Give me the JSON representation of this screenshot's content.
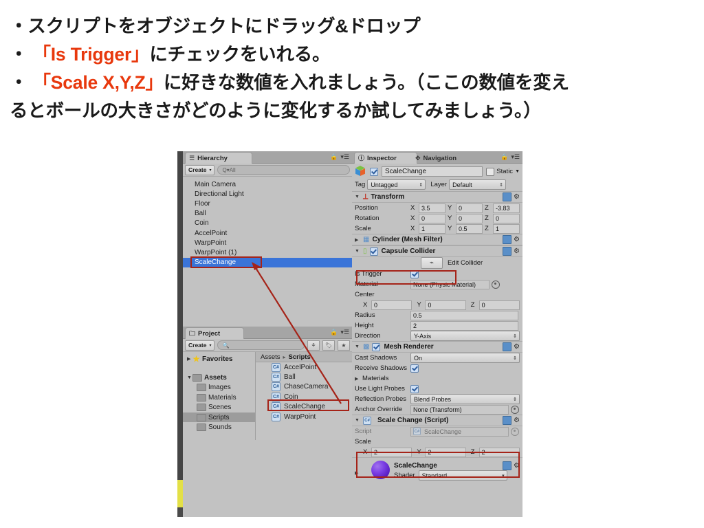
{
  "slide": {
    "lines": [
      {
        "id": "l1",
        "segments": [
          {
            "text": "・スクリプトをオブジェクトにドラッグ&ドロップ",
            "color": "black"
          }
        ]
      },
      {
        "id": "l2",
        "segments": [
          {
            "text": "・ ",
            "color": "black"
          },
          {
            "text": "「Is Trigger」",
            "color": "red"
          },
          {
            "text": "にチェックをいれる。",
            "color": "black"
          }
        ]
      },
      {
        "id": "l3",
        "segments": [
          {
            "text": "・ ",
            "color": "black"
          },
          {
            "text": "「Scale X,Y,Z」",
            "color": "red"
          },
          {
            "text": "に好きな数値を入れましょう。（ここの数値を変え",
            "color": "black"
          }
        ]
      },
      {
        "id": "l4",
        "segments": [
          {
            "text": "るとボールの大きさがどのように変化するか試してみましょう。）",
            "color": "black"
          }
        ]
      }
    ],
    "accent_red": "#e8380d",
    "text_black": "#1a1a1a"
  },
  "hierarchy": {
    "tab_label": "Hierarchy",
    "tab_icon": "hierarchy-icon",
    "create_label": "Create",
    "search_placeholder": "Q▾All",
    "items": [
      {
        "label": "Main Camera",
        "selected": false
      },
      {
        "label": "Directional Light",
        "selected": false
      },
      {
        "label": "Floor",
        "selected": false
      },
      {
        "label": "Ball",
        "selected": false
      },
      {
        "label": "Coin",
        "selected": false
      },
      {
        "label": "AccelPoint",
        "selected": false
      },
      {
        "label": "WarpPoint",
        "selected": false
      },
      {
        "label": "WarpPoint (1)",
        "selected": false
      },
      {
        "label": "ScaleChange",
        "selected": true
      }
    ]
  },
  "project": {
    "tab_label": "Project",
    "create_label": "Create",
    "search_placeholder": "",
    "breadcrumb": {
      "root": "Assets",
      "sep": "▸",
      "current": "Scripts"
    },
    "tree": [
      {
        "label": "Favorites",
        "kind": "star",
        "bold": true,
        "arrow": "▶",
        "indent": 0,
        "selected": false
      },
      {
        "label": "",
        "kind": "spacer",
        "bold": false,
        "arrow": "",
        "indent": 0,
        "selected": false
      },
      {
        "label": "Assets",
        "kind": "folder",
        "bold": true,
        "arrow": "▼",
        "indent": 0,
        "selected": false
      },
      {
        "label": "Images",
        "kind": "folder",
        "bold": false,
        "arrow": "",
        "indent": 1,
        "selected": false
      },
      {
        "label": "Materials",
        "kind": "folder",
        "bold": false,
        "arrow": "",
        "indent": 1,
        "selected": false
      },
      {
        "label": "Scenes",
        "kind": "folder",
        "bold": false,
        "arrow": "",
        "indent": 1,
        "selected": false
      },
      {
        "label": "Scripts",
        "kind": "folder",
        "bold": false,
        "arrow": "",
        "indent": 1,
        "selected": true
      },
      {
        "label": "Sounds",
        "kind": "folder",
        "bold": false,
        "arrow": "",
        "indent": 1,
        "selected": false
      }
    ],
    "assets": [
      {
        "label": "AccelPoint",
        "icon": "csharp-script-icon"
      },
      {
        "label": "Ball",
        "icon": "csharp-script-icon"
      },
      {
        "label": "ChaseCamera",
        "icon": "csharp-script-icon"
      },
      {
        "label": "Coin",
        "icon": "csharp-script-icon"
      },
      {
        "label": "ScaleChange",
        "icon": "csharp-script-icon"
      },
      {
        "label": "WarpPoint",
        "icon": "csharp-script-icon"
      }
    ]
  },
  "inspector": {
    "tab_label": "Inspector",
    "tab2_label": "Navigation",
    "object_name": "ScaleChange",
    "object_enabled": true,
    "static_label": "Static",
    "tag_label": "Tag",
    "tag_value": "Untagged",
    "layer_label": "Layer",
    "layer_value": "Default",
    "transform": {
      "title": "Transform",
      "rows": [
        {
          "label": "Position",
          "x": "3.5",
          "y": "0",
          "z": "-3.83"
        },
        {
          "label": "Rotation",
          "x": "0",
          "y": "0",
          "z": "0"
        },
        {
          "label": "Scale",
          "x": "1",
          "y": "0.5",
          "z": "1"
        }
      ]
    },
    "mesh_filter": {
      "title": "Cylinder (Mesh Filter)",
      "collapsed": true
    },
    "capsule_collider": {
      "title": "Capsule Collider",
      "enabled": true,
      "edit_collider_label": "Edit Collider",
      "is_trigger_label": "Is Trigger",
      "is_trigger_value": true,
      "material_label": "Material",
      "material_value": "None (Physic Material)",
      "center_label": "Center",
      "center": {
        "x": "0",
        "y": "0",
        "z": "0"
      },
      "radius_label": "Radius",
      "radius_value": "0.5",
      "height_label": "Height",
      "height_value": "2",
      "direction_label": "Direction",
      "direction_value": "Y-Axis"
    },
    "mesh_renderer": {
      "title": "Mesh Renderer",
      "enabled": true,
      "cast_shadows_label": "Cast Shadows",
      "cast_shadows_value": "On",
      "receive_shadows_label": "Receive Shadows",
      "receive_shadows_value": true,
      "materials_label": "Materials",
      "use_light_probes_label": "Use Light Probes",
      "use_light_probes_value": true,
      "reflection_probes_label": "Reflection Probes",
      "reflection_probes_value": "Blend Probes",
      "anchor_override_label": "Anchor Override",
      "anchor_override_value": "None (Transform)"
    },
    "scale_change_script": {
      "title": "Scale Change (Script)",
      "script_label": "Script",
      "script_value": "ScaleChange",
      "scale_label": "Scale",
      "scale": {
        "x": "2",
        "y": "2",
        "z": "2"
      }
    },
    "material": {
      "name": "ScaleChange",
      "shader_label": "Shader",
      "shader_value": "Standard",
      "preview_color": "#7b3fe4"
    }
  },
  "annotations": {
    "highlight_color": "#a52318",
    "arrow_from": "project-asset-scalechange",
    "arrow_to": "hierarchy-item-scalechange"
  }
}
